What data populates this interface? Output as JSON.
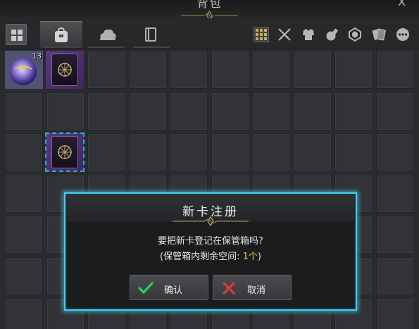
{
  "window": {
    "title": "背包",
    "close_label": "X"
  },
  "toolbar": {
    "sort_icon": "grid-sort-icon",
    "tabs": [
      {
        "icon": "bag-icon",
        "active": true
      },
      {
        "icon": "cloud-hat-icon",
        "active": false
      },
      {
        "icon": "book-icon",
        "active": false
      }
    ],
    "filters": [
      {
        "icon": "all-grid-icon",
        "active": true
      },
      {
        "icon": "crossed-swords-icon",
        "active": false
      },
      {
        "icon": "armor-icon",
        "active": false
      },
      {
        "icon": "potion-icon",
        "active": false
      },
      {
        "icon": "gem-icon",
        "active": false
      },
      {
        "icon": "cards-icon",
        "active": false
      },
      {
        "icon": "more-icon",
        "active": false
      }
    ]
  },
  "inventory": {
    "items": [
      {
        "type": "orb",
        "count": "13"
      },
      {
        "type": "card"
      },
      {
        "type": "card",
        "selected": true
      }
    ]
  },
  "dialog": {
    "title": "新卡注册",
    "message": "要把新卡登记在保管箱吗?",
    "sub_prefix": "(保管箱内剩余空间: ",
    "sub_value": "1个",
    "sub_suffix": ")",
    "confirm_label": "确认",
    "cancel_label": "取消"
  },
  "colors": {
    "dialog_border": "#3fd1f2",
    "highlight": "#e9c44a",
    "confirm_icon": "#2fcf5a",
    "cancel_icon": "#e23a3a",
    "card_purple": "#6d3f95"
  }
}
